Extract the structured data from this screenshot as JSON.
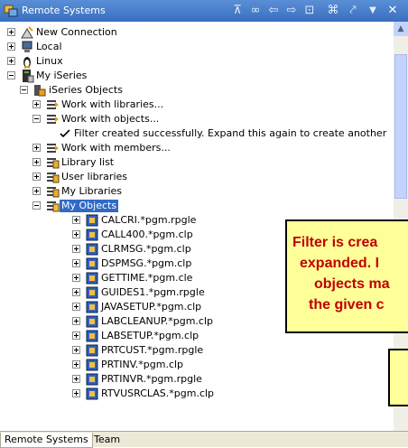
{
  "titlebar": {
    "title": "Remote Systems"
  },
  "toolbar": {
    "icons": [
      "filter-icon",
      "link-icon",
      "back-icon",
      "forward-icon",
      "home-icon",
      "collapse-icon",
      "refresh-icon",
      "menu-icon",
      "close-icon"
    ]
  },
  "tree": {
    "new_connection": "New Connection",
    "local": "Local",
    "linux": "Linux",
    "my_iseries": "My iSeries",
    "iseries_objects": "iSeries Objects",
    "work_with_libraries": "Work with libraries...",
    "work_with_objects": "Work with objects...",
    "filter_msg": "Filter created successfully. Expand this again to create another",
    "work_with_members": "Work with members...",
    "library_list": "Library list",
    "user_libraries": "User libraries",
    "my_libraries": "My Libraries",
    "my_objects": "My Objects",
    "objects": [
      "CALCRI.*pgm.rpgle",
      "CALL400.*pgm.clp",
      "CLRMSG.*pgm.clp",
      "DSPMSG.*pgm.clp",
      "GETTIME.*pgm.cle",
      "GUIDES1.*pgm.rpgle",
      "JAVASETUP.*pgm.clp",
      "LABCLEANUP.*pgm.clp",
      "LABSETUP.*pgm.clp",
      "PRTCUST.*pgm.rpgle",
      "PRTINV.*pgm.clp",
      "PRTINVR.*pgm.rpgle",
      "RTVUSRCLAS.*pgm.clp"
    ]
  },
  "tabs": {
    "remote_systems": "Remote Systems",
    "team": "Team"
  },
  "callout": {
    "line1": "Filter is crea",
    "line2": "expanded. I",
    "line3": "objects ma",
    "line4": "the given c"
  },
  "colors": {
    "accent": "#316ac5",
    "callout_bg": "#ffff99",
    "callout_text": "#c00000"
  }
}
